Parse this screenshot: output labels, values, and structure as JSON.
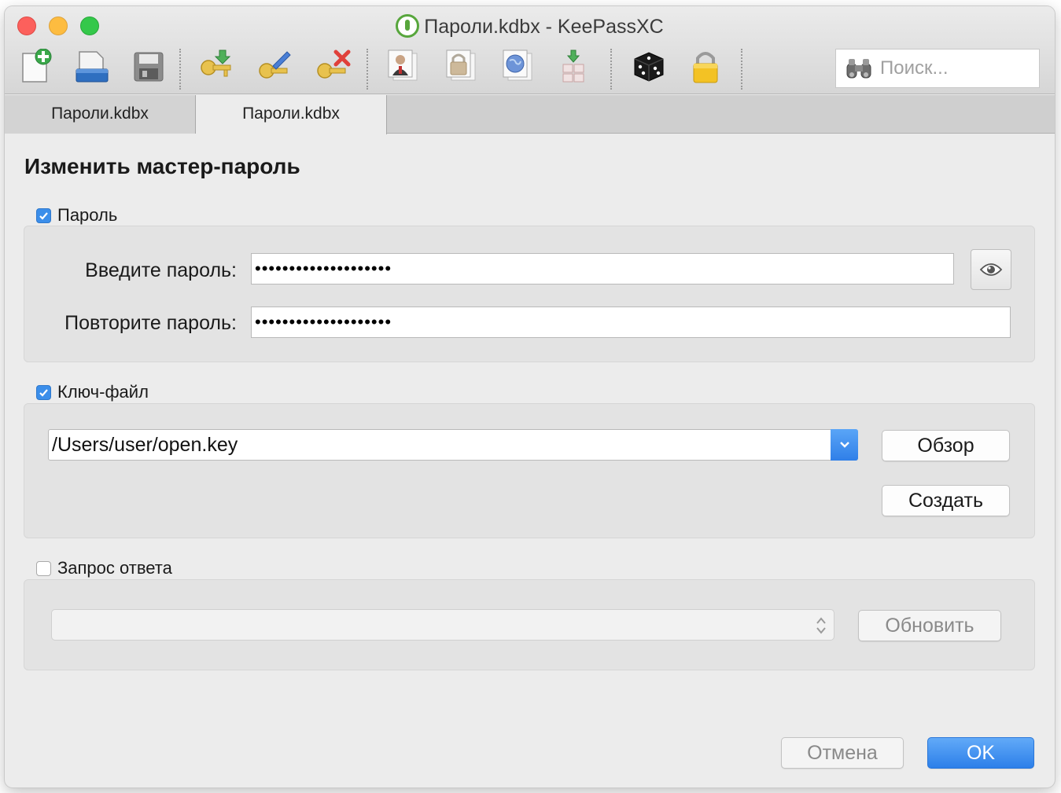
{
  "window": {
    "title": "Пароли.kdbx - KeePassXC"
  },
  "toolbar": {
    "items": [
      {
        "name": "new-database-icon"
      },
      {
        "name": "open-database-icon"
      },
      {
        "name": "save-database-icon"
      },
      {
        "name": "add-entry-icon"
      },
      {
        "name": "edit-entry-icon"
      },
      {
        "name": "delete-entry-icon"
      },
      {
        "name": "copy-username-icon"
      },
      {
        "name": "copy-password-icon"
      },
      {
        "name": "open-url-icon"
      },
      {
        "name": "autotype-icon"
      },
      {
        "name": "password-generator-icon"
      },
      {
        "name": "lock-database-icon"
      }
    ],
    "search_placeholder": "Поиск..."
  },
  "tabs": [
    {
      "label": "Пароли.kdbx",
      "active": false
    },
    {
      "label": "Пароли.kdbx",
      "active": true
    }
  ],
  "dialog": {
    "heading": "Изменить мастер-пароль",
    "password_section": {
      "checkbox_label": "Пароль",
      "checked": true,
      "enter_label": "Введите пароль:",
      "enter_value": "••••••••••••••••••••",
      "repeat_label": "Повторите пароль:",
      "repeat_value": "••••••••••••••••••••"
    },
    "keyfile_section": {
      "checkbox_label": "Ключ-файл",
      "checked": true,
      "path_value": "/Users/user/open.key",
      "browse_label": "Обзор",
      "create_label": "Создать"
    },
    "challenge_section": {
      "checkbox_label": "Запрос ответа",
      "checked": false,
      "refresh_label": "Обновить"
    },
    "cancel_label": "Отмена",
    "ok_label": "OK"
  },
  "colors": {
    "accent": "#3b8eea",
    "close": "#fc605c",
    "minimize": "#fdbc40",
    "maximize": "#34c84a"
  }
}
